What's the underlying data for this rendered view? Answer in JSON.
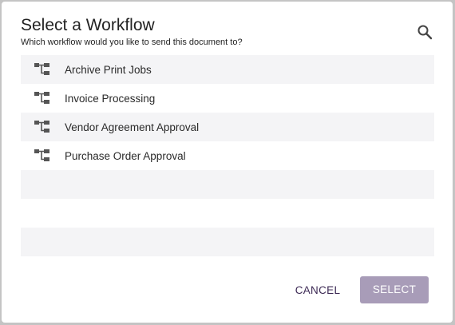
{
  "dialog": {
    "title": "Select a Workflow",
    "subtitle": "Which workflow would you like to send this document to?"
  },
  "icons": {
    "search": "search-icon",
    "workflow": "workflow-icon"
  },
  "workflows": [
    {
      "label": "Archive Print Jobs"
    },
    {
      "label": "Invoice Processing"
    },
    {
      "label": "Vendor Agreement Approval"
    },
    {
      "label": "Purchase Order Approval"
    }
  ],
  "actions": {
    "cancel_label": "CANCEL",
    "select_label": "SELECT",
    "select_enabled": false
  },
  "colors": {
    "accent": "#3d2a55",
    "select_disabled_bg": "#a89cb8",
    "row_stripe": "#f4f4f6"
  }
}
